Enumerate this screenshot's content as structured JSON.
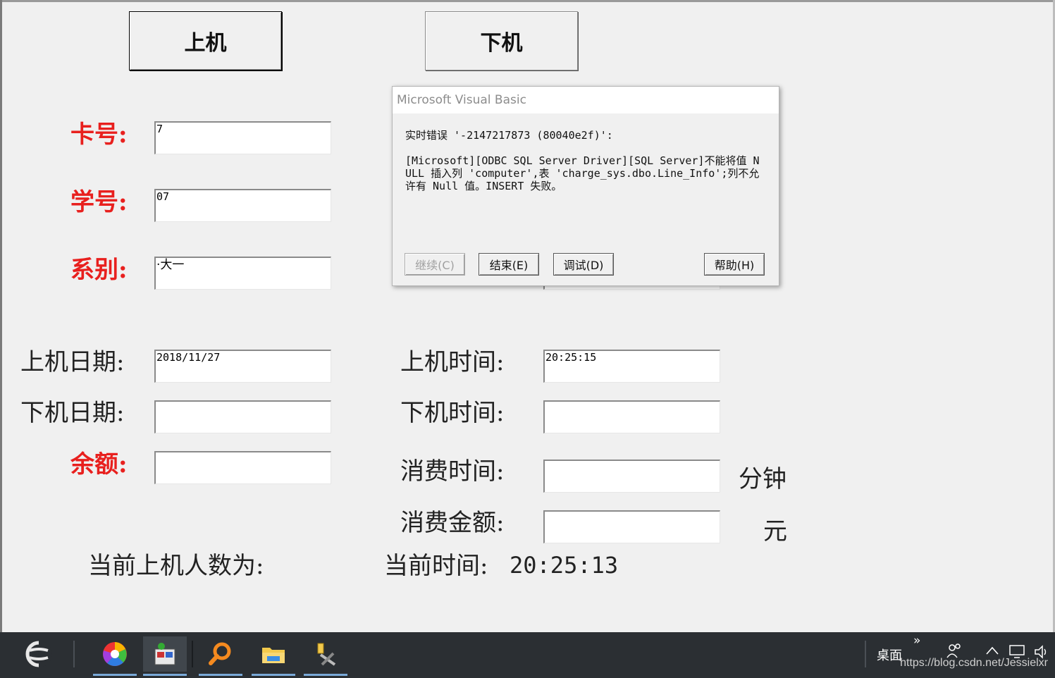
{
  "form": {
    "login_button": "上机",
    "logout_button": "下机",
    "labels": {
      "card_no": "卡号:",
      "student_no": "学号:",
      "department": "系别:",
      "login_date": "上机日期:",
      "logout_date": "下机日期:",
      "balance": "余额:",
      "login_time": "上机时间:",
      "logout_time": "下机时间:",
      "consume_time": "消费时间:",
      "consume_amount": "消费金额:",
      "online_count": "当前上机人数为:",
      "current_time_label": "当前时间:"
    },
    "values": {
      "card_no": "7",
      "student_no": "07",
      "department": "·大一",
      "login_date": "2018/11/27",
      "login_time": "20:25:15",
      "logout_date": "",
      "logout_time": "",
      "balance": "",
      "consume_time": "",
      "consume_amount": "",
      "current_time": "20:25:13"
    },
    "units": {
      "minutes": "分钟",
      "yuan": "元"
    }
  },
  "dialog": {
    "title": "Microsoft Visual Basic",
    "error_line": "实时错误 '-2147217873 (80040e2f)':",
    "message": "[Microsoft][ODBC SQL Server Driver][SQL Server]不能将值 NULL 插入列 'computer',表 'charge_sys.dbo.Line_Info';列不允许有 Null 值。INSERT 失败。",
    "buttons": {
      "continue": "继续(C)",
      "end": "结束(E)",
      "debug": "调试(D)",
      "help": "帮助(H)"
    }
  },
  "taskbar": {
    "desktop_label": "桌面",
    "chevron": "»",
    "watermark": "https://blog.csdn.net/Jessielxr",
    "icons": [
      "start-icon",
      "color-wheel-icon",
      "vb6-icon",
      "search-icon",
      "file-explorer-icon",
      "tools-icon"
    ]
  }
}
